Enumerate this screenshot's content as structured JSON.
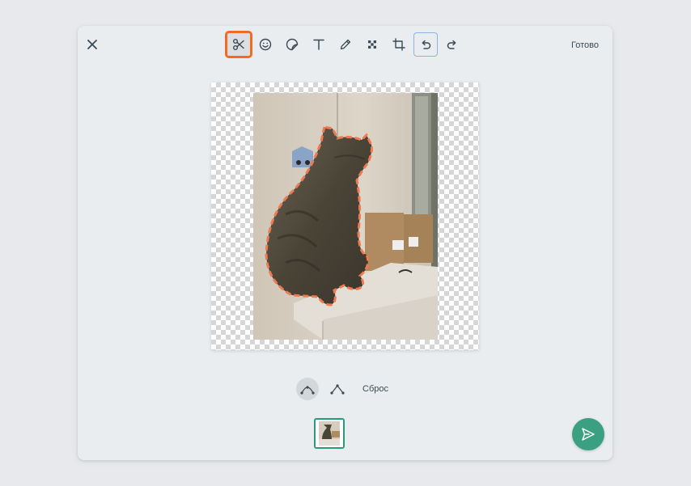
{
  "toolbar": {
    "done_label": "Готово",
    "tools": [
      {
        "icon": "scissors-icon",
        "active": true
      },
      {
        "icon": "emoji-icon"
      },
      {
        "icon": "sticker-icon"
      },
      {
        "icon": "text-icon"
      },
      {
        "icon": "pencil-icon"
      },
      {
        "icon": "blur-icon"
      },
      {
        "icon": "crop-icon"
      },
      {
        "icon": "undo-icon"
      },
      {
        "icon": "redo-icon"
      }
    ]
  },
  "cutout_tools": {
    "reset_label": "Сброс",
    "modes": [
      "curve-mode-icon",
      "polygon-mode-icon"
    ]
  },
  "colors": {
    "accent": "#f26b23",
    "send": "#3aa07f",
    "thumb_border": "#2c9a7a"
  }
}
